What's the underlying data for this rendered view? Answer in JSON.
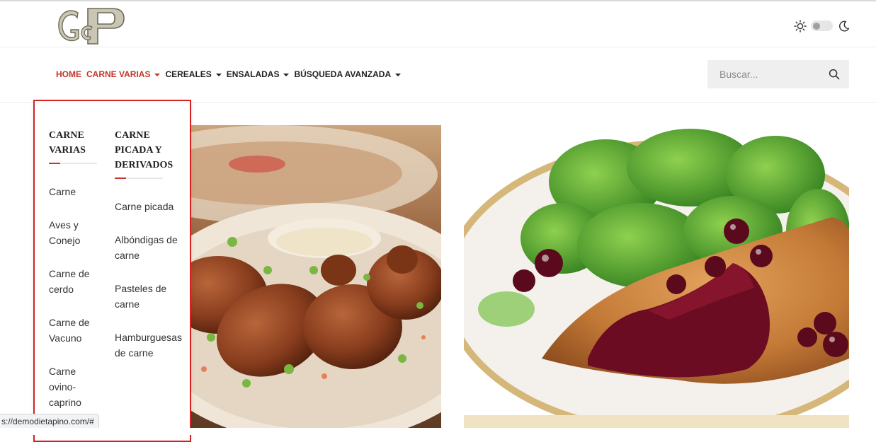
{
  "header": {
    "logo_letters": "GPC"
  },
  "nav": {
    "items": [
      {
        "label": "HOME",
        "has_dropdown": false
      },
      {
        "label": "CARNE VARIAS",
        "has_dropdown": true
      },
      {
        "label": "CEREALES",
        "has_dropdown": true
      },
      {
        "label": "ENSALADAS",
        "has_dropdown": true
      },
      {
        "label": "BÚSQUEDA AVANZADA",
        "has_dropdown": true
      }
    ],
    "accent_color": "#c4352b"
  },
  "search": {
    "placeholder": "Buscar...",
    "value": ""
  },
  "theme_toggle": {
    "mode": "light",
    "icons": [
      "sun-icon",
      "moon-icon"
    ]
  },
  "dropdown": {
    "columns": [
      {
        "title_lines": [
          "CARNE",
          "VARIAS"
        ],
        "links": [
          {
            "lines": [
              "Carne"
            ]
          },
          {
            "lines": [
              "Aves y",
              "Conejo"
            ]
          },
          {
            "lines": [
              "Carne de",
              "cerdo"
            ]
          },
          {
            "lines": [
              "Carne de",
              "Vacuno"
            ]
          },
          {
            "lines": [
              "Carne",
              "ovino-",
              "caprino"
            ]
          }
        ]
      },
      {
        "title_lines": [
          "CARNE",
          "PICADA Y",
          "DERIVADOS"
        ],
        "links": [
          {
            "lines": [
              "Carne picada"
            ]
          },
          {
            "lines": [
              "Albóndigas de",
              "carne"
            ]
          },
          {
            "lines": [
              "Pasteles de",
              "carne"
            ]
          },
          {
            "lines": [
              "Hamburguesas",
              "de carne"
            ]
          }
        ]
      }
    ],
    "border_color": "#d42222"
  },
  "status": {
    "url": "s://demodietapino.com/#"
  }
}
